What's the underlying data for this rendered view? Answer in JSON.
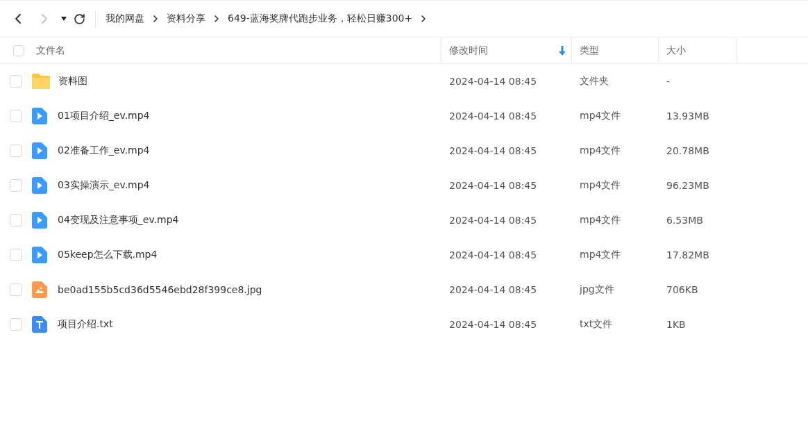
{
  "toolbar": {
    "breadcrumbs": [
      "我的网盘",
      "资料分享",
      "649-蓝海奖牌代跑步业务，轻松日赚300+"
    ]
  },
  "table": {
    "columns": [
      {
        "label": "文件名",
        "sorted": false
      },
      {
        "label": "修改时间",
        "sorted": true
      },
      {
        "label": "类型",
        "sorted": false
      },
      {
        "label": "大小",
        "sorted": false
      }
    ],
    "all_checked": false,
    "rows": [
      {
        "kind": "folder",
        "name": "资料图",
        "modified": "2024-04-14 08:45",
        "type": "文件夹",
        "size": "-",
        "checked": false
      },
      {
        "kind": "video",
        "name": "01项目介绍_ev.mp4",
        "modified": "2024-04-14 08:45",
        "type": "mp4文件",
        "size": "13.93MB",
        "checked": false
      },
      {
        "kind": "video",
        "name": "02准备工作_ev.mp4",
        "modified": "2024-04-14 08:45",
        "type": "mp4文件",
        "size": "20.78MB",
        "checked": false
      },
      {
        "kind": "video",
        "name": "03实操演示_ev.mp4",
        "modified": "2024-04-14 08:45",
        "type": "mp4文件",
        "size": "96.23MB",
        "checked": false
      },
      {
        "kind": "video",
        "name": "04变现及注意事项_ev.mp4",
        "modified": "2024-04-14 08:45",
        "type": "mp4文件",
        "size": "6.53MB",
        "checked": false
      },
      {
        "kind": "video",
        "name": "05keep怎么下载.mp4",
        "modified": "2024-04-14 08:45",
        "type": "mp4文件",
        "size": "17.82MB",
        "checked": false
      },
      {
        "kind": "image",
        "name": "be0ad155b5cd36d5546ebd28f399ce8.jpg",
        "modified": "2024-04-14 08:45",
        "type": "jpg文件",
        "size": "706KB",
        "checked": false
      },
      {
        "kind": "text",
        "name": "项目介绍.txt",
        "modified": "2024-04-14 08:45",
        "type": "txt文件",
        "size": "1KB",
        "checked": false
      }
    ]
  }
}
